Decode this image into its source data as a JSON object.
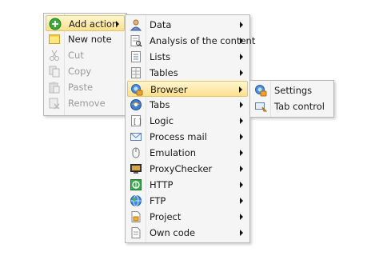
{
  "menu_main": {
    "items": [
      {
        "label": "Add action",
        "icon": "add-circle-icon",
        "disabled": false,
        "submenu": true,
        "highlighted": true
      },
      {
        "label": "New note",
        "icon": "note-icon",
        "disabled": false,
        "submenu": false
      },
      {
        "label": "Cut",
        "icon": "scissors-icon",
        "disabled": true,
        "submenu": false
      },
      {
        "label": "Copy",
        "icon": "copy-icon",
        "disabled": true,
        "submenu": false
      },
      {
        "label": "Paste",
        "icon": "paste-icon",
        "disabled": true,
        "submenu": false
      },
      {
        "label": "Remove",
        "icon": "remove-icon",
        "disabled": true,
        "submenu": false
      }
    ]
  },
  "menu_actions": {
    "items": [
      {
        "label": "Data",
        "icon": "user-data-icon"
      },
      {
        "label": "Analysis of the content",
        "icon": "analysis-icon"
      },
      {
        "label": "Lists",
        "icon": "list-icon"
      },
      {
        "label": "Tables",
        "icon": "table-icon"
      },
      {
        "label": "Browser",
        "icon": "browser-icon",
        "highlighted": true
      },
      {
        "label": "Tabs",
        "icon": "tabs-icon"
      },
      {
        "label": "Logic",
        "icon": "logic-icon"
      },
      {
        "label": "Process mail",
        "icon": "mail-icon"
      },
      {
        "label": "Emulation",
        "icon": "mouse-icon"
      },
      {
        "label": "ProxyChecker",
        "icon": "proxy-checker-icon"
      },
      {
        "label": "HTTP",
        "icon": "http-icon"
      },
      {
        "label": "FTP",
        "icon": "ftp-globe-icon"
      },
      {
        "label": "Project",
        "icon": "project-icon"
      },
      {
        "label": "Own code",
        "icon": "own-code-icon"
      }
    ]
  },
  "menu_browser": {
    "items": [
      {
        "label": "Settings",
        "icon": "browser-settings-icon"
      },
      {
        "label": "Tab control",
        "icon": "tab-control-icon"
      }
    ]
  },
  "colors": {
    "menu_bg": "#f5f5f5",
    "border": "#b7b7b7",
    "highlight_top": "#fff6cf",
    "highlight_bottom": "#fbe08d",
    "disabled_text": "#9a9a9a"
  }
}
